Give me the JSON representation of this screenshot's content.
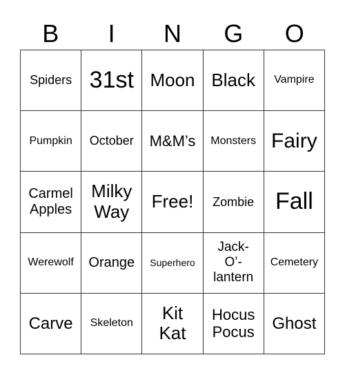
{
  "header": [
    "B",
    "I",
    "N",
    "G",
    "O"
  ],
  "cells": [
    [
      "Spiders",
      "31st",
      "Moon",
      "Black",
      "Vampire"
    ],
    [
      "Pumpkin",
      "October",
      "M&M’s",
      "Monsters",
      "Fairy"
    ],
    [
      "Carmel Apples",
      "Milky Way",
      "Free!",
      "Zombie",
      "Fall"
    ],
    [
      "Werewolf",
      "Orange",
      "Superhero",
      "Jack-O’-lantern",
      "Cemetery"
    ],
    [
      "Carve",
      "Skeleton",
      "Kit Kat",
      "Hocus Pocus",
      "Ghost"
    ]
  ]
}
